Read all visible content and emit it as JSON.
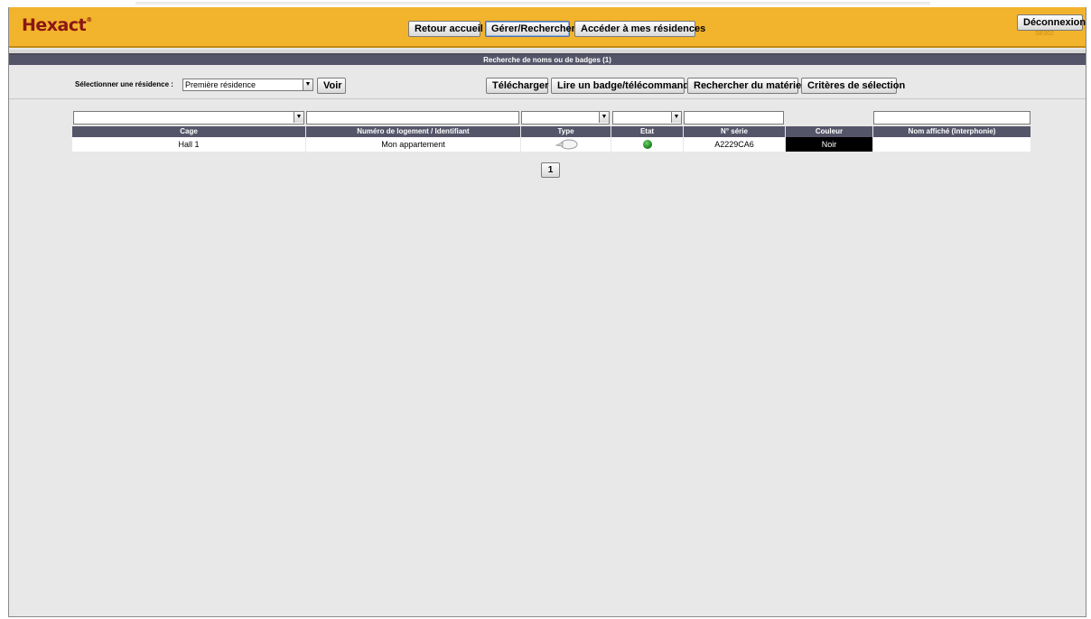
{
  "brand": {
    "logo_text": "Hexact",
    "logo_mark": "®"
  },
  "header": {
    "nav": [
      "Retour accueil",
      "Gérer/Rechercher",
      "Accéder à mes résidences"
    ],
    "logout_label": "Déconnexion",
    "build_label": "SE002"
  },
  "title_bar": {
    "text": "Recherche de noms ou de badges (1)"
  },
  "toolbar": {
    "select_label": "Sélectionner une résidence :",
    "select_value": "Première résidence",
    "voir_label": "Voir",
    "actions": [
      "Télécharger",
      "Lire un badge/télécommande",
      "Rechercher du matériel",
      "Critères de sélection"
    ]
  },
  "table": {
    "columns": [
      "Cage",
      "Numéro de logement / Identifiant",
      "Type",
      "Etat",
      "N° série",
      "Couleur",
      "Nom affiché (Interphonie)"
    ],
    "rows": [
      {
        "cage": "Hall 1",
        "logement": "Mon appartement",
        "type_icon": "badge-fob-icon",
        "etat_icon": "status-active-icon",
        "serie": "A2229CA6",
        "couleur": "Noir",
        "nom": ""
      }
    ]
  },
  "pagination": {
    "current_page": "1"
  },
  "colors": {
    "header": "#f2b42c",
    "title_bar": "#55556a",
    "logo": "#8a1616",
    "status_ok": "#1f8a1f"
  }
}
